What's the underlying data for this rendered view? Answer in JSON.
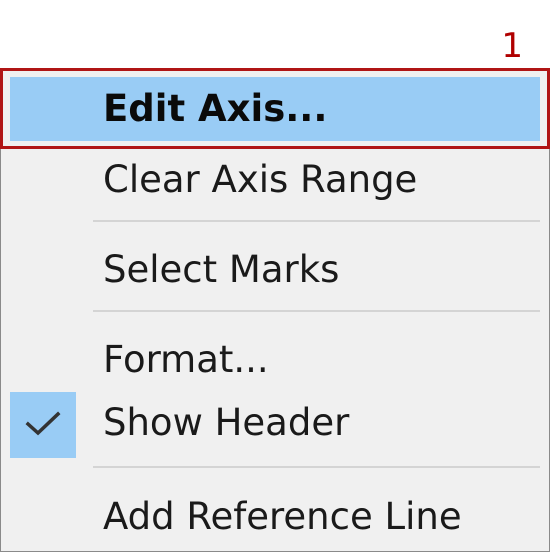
{
  "annotation": {
    "step_number": "1"
  },
  "menu": {
    "items": [
      {
        "label": "Edit Axis...",
        "highlighted": true
      },
      {
        "label": "Clear Axis Range"
      },
      {
        "label": "Select Marks"
      },
      {
        "label": "Format..."
      },
      {
        "label": "Show Header",
        "checked": true
      },
      {
        "label": "Add Reference Line"
      }
    ],
    "check_icon": "checkmark-icon"
  },
  "colors": {
    "menu_background": "#f0f0f0",
    "highlight": "#99ccf5",
    "annotation_red": "#b01515"
  }
}
